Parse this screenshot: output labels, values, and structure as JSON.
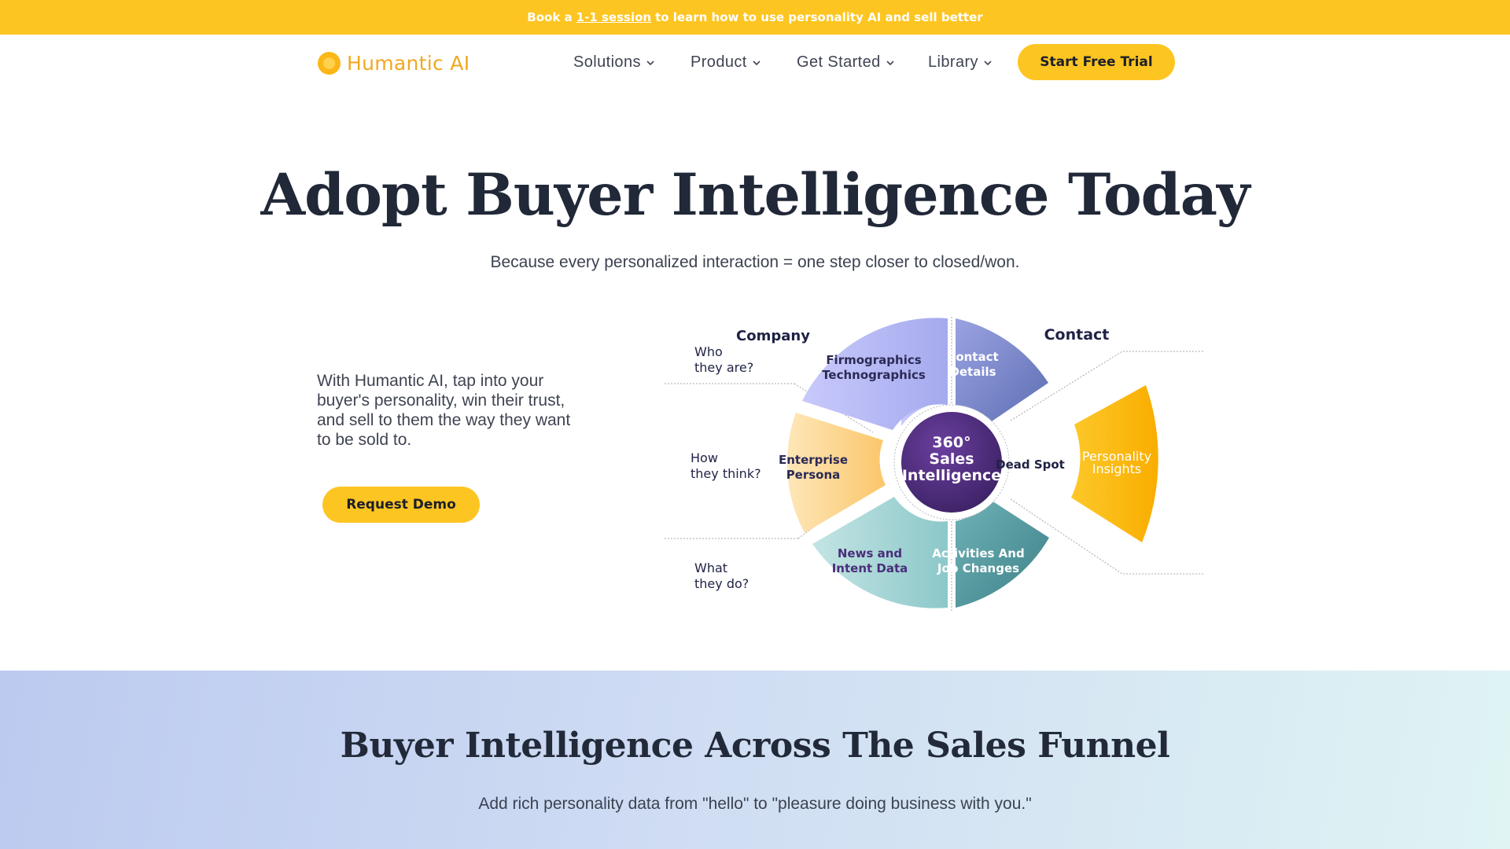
{
  "announcement": {
    "prefix": "Book a",
    "link": "1-1 session",
    "suffix": "to learn how to use personality AI and sell better"
  },
  "nav": {
    "logo_text": "Humantic AI",
    "items": [
      {
        "label": "Solutions"
      },
      {
        "label": "Product"
      },
      {
        "label": "Get Started"
      },
      {
        "label": "Library"
      }
    ],
    "cta": "Start Free Trial"
  },
  "hero": {
    "title": "Adopt Buyer Intelligence Today",
    "subtitle": "Because every personalized interaction = one step closer to closed/won.",
    "body": "With Humantic AI, tap into your buyer's personality, win their trust, and sell to them the way they want to be sold to.",
    "cta": "Request Demo"
  },
  "diagram": {
    "center": [
      "360°",
      "Sales",
      "Intelligence"
    ],
    "headings": {
      "company": "Company",
      "contact": "Contact"
    },
    "questions": {
      "who": [
        "Who",
        "they are?"
      ],
      "how": [
        "How",
        "they think?"
      ],
      "what": [
        "What",
        "they do?"
      ]
    },
    "segments": {
      "firmographics": [
        "Firmographics",
        "Technographics"
      ],
      "contact_details": [
        "Contact",
        "Details"
      ],
      "enterprise_persona": [
        "Enterprise",
        "Persona"
      ],
      "dead_spot": "Dead Spot",
      "personality": [
        "Personality",
        "Insights"
      ],
      "news": [
        "News and",
        "Intent Data"
      ],
      "activities": [
        "Activities And",
        "Job Changes"
      ]
    },
    "colors": {
      "purple": "#a9aef0",
      "purple_dark": "#6f7bc4",
      "yellow": "#fbb617",
      "teal": "#5aa3ad",
      "center": "#4b2a7a"
    }
  },
  "funnel": {
    "title": "Buyer Intelligence Across The Sales Funnel",
    "subtitle": "Add rich personality data from \"hello\" to \"pleasure doing business with you.\""
  }
}
